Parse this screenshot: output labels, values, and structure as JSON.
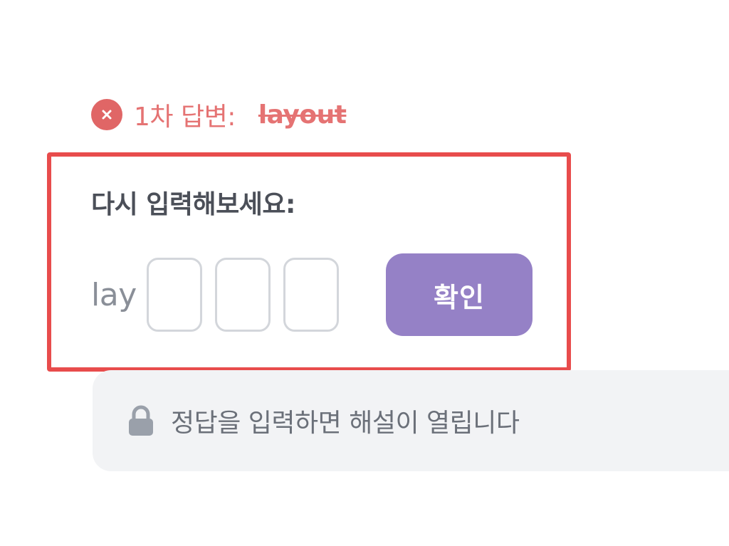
{
  "first_attempt": {
    "label": "1차 답변:",
    "answer": "layout",
    "status_icon": "error-x-icon"
  },
  "retry": {
    "prompt": "다시 입력해보세요:",
    "prefix": "lay",
    "input_boxes": [
      "",
      "",
      ""
    ],
    "confirm_label": "확인"
  },
  "explanation": {
    "locked_text": "정답을 입력하면 해설이 열립니다",
    "icon": "lock-icon"
  },
  "colors": {
    "error": "#e57373",
    "highlight_border": "#e84c4c",
    "button": "#9581c6",
    "locked_bg": "#f2f3f5"
  }
}
